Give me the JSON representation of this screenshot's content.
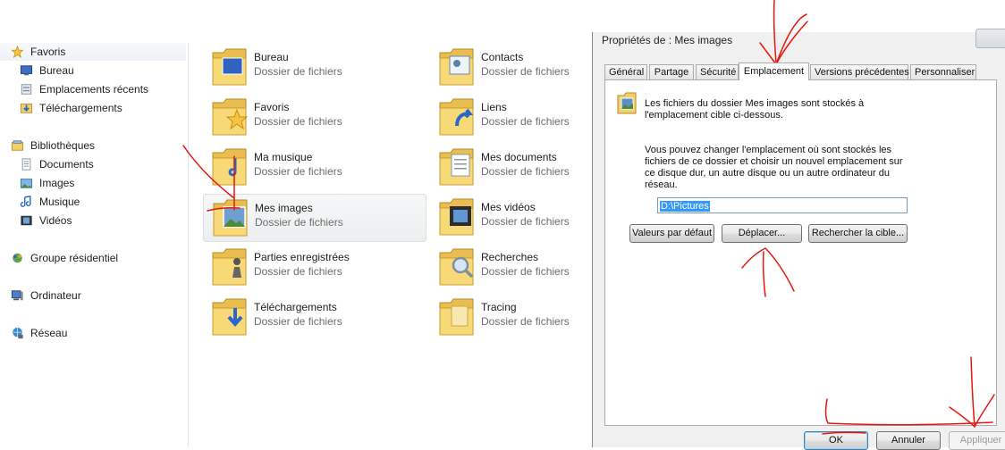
{
  "navigation": {
    "favorites": {
      "label": "Favoris",
      "items": [
        {
          "label": "Bureau",
          "icon": "desktop-icon"
        },
        {
          "label": "Emplacements récents",
          "icon": "recent-places-icon"
        },
        {
          "label": "Téléchargements",
          "icon": "downloads-icon"
        }
      ]
    },
    "libraries": {
      "label": "Bibliothèques",
      "items": [
        {
          "label": "Documents",
          "icon": "documents-icon"
        },
        {
          "label": "Images",
          "icon": "images-icon"
        },
        {
          "label": "Musique",
          "icon": "music-icon"
        },
        {
          "label": "Vidéos",
          "icon": "videos-icon"
        }
      ]
    },
    "homegroup": {
      "label": "Groupe résidentiel"
    },
    "computer": {
      "label": "Ordinateur"
    },
    "network": {
      "label": "Réseau"
    }
  },
  "folders": [
    {
      "name": "Bureau",
      "type": "Dossier de fichiers",
      "overlay": "desktop-icon"
    },
    {
      "name": "Contacts",
      "type": "Dossier de fichiers",
      "overlay": "contacts-icon"
    },
    {
      "name": "Favoris",
      "type": "Dossier de fichiers",
      "overlay": "star-icon"
    },
    {
      "name": "Liens",
      "type": "Dossier de fichiers",
      "overlay": "shortcut-arrow-icon"
    },
    {
      "name": "Ma musique",
      "type": "Dossier de fichiers",
      "overlay": "music-note-icon"
    },
    {
      "name": "Mes documents",
      "type": "Dossier de fichiers",
      "overlay": "document-icon"
    },
    {
      "name": "Mes images",
      "type": "Dossier de fichiers",
      "overlay": "picture-icon",
      "selected": true
    },
    {
      "name": "Mes vidéos",
      "type": "Dossier de fichiers",
      "overlay": "film-icon"
    },
    {
      "name": "Parties enregistrées",
      "type": "Dossier de fichiers",
      "overlay": "chess-piece-icon"
    },
    {
      "name": "Recherches",
      "type": "Dossier de fichiers",
      "overlay": "magnifier-icon"
    },
    {
      "name": "Téléchargements",
      "type": "Dossier de fichiers",
      "overlay": "download-arrow-icon"
    },
    {
      "name": "Tracing",
      "type": "Dossier de fichiers",
      "overlay": "none"
    }
  ],
  "dialog": {
    "title": "Propriétés de : Mes images",
    "tabs": [
      "Général",
      "Partage",
      "Sécurité",
      "Emplacement",
      "Versions précédentes",
      "Personnaliser"
    ],
    "active_tab": "Emplacement",
    "info_text": [
      "Les fichiers du dossier Mes images sont stockés à",
      "l'emplacement cible ci-dessous."
    ],
    "change_text": [
      "Vous pouvez changer l'emplacement où sont stockés les",
      "fichiers de ce dossier et choisir un nouvel emplacement sur",
      "ce disque dur, un autre disque ou un autre ordinateur du",
      "réseau."
    ],
    "path_value": "D:\\Pictures",
    "buttons": {
      "restore_default": "Valeurs par défaut",
      "move": "Déplacer...",
      "find_target": "Rechercher la cible..."
    },
    "footer": {
      "ok": "OK",
      "cancel": "Annuler",
      "apply": "Appliquer"
    }
  },
  "colors": {
    "annotation": "#e8160c",
    "selection": "#3399ff",
    "folder": "#f2cf6b"
  }
}
